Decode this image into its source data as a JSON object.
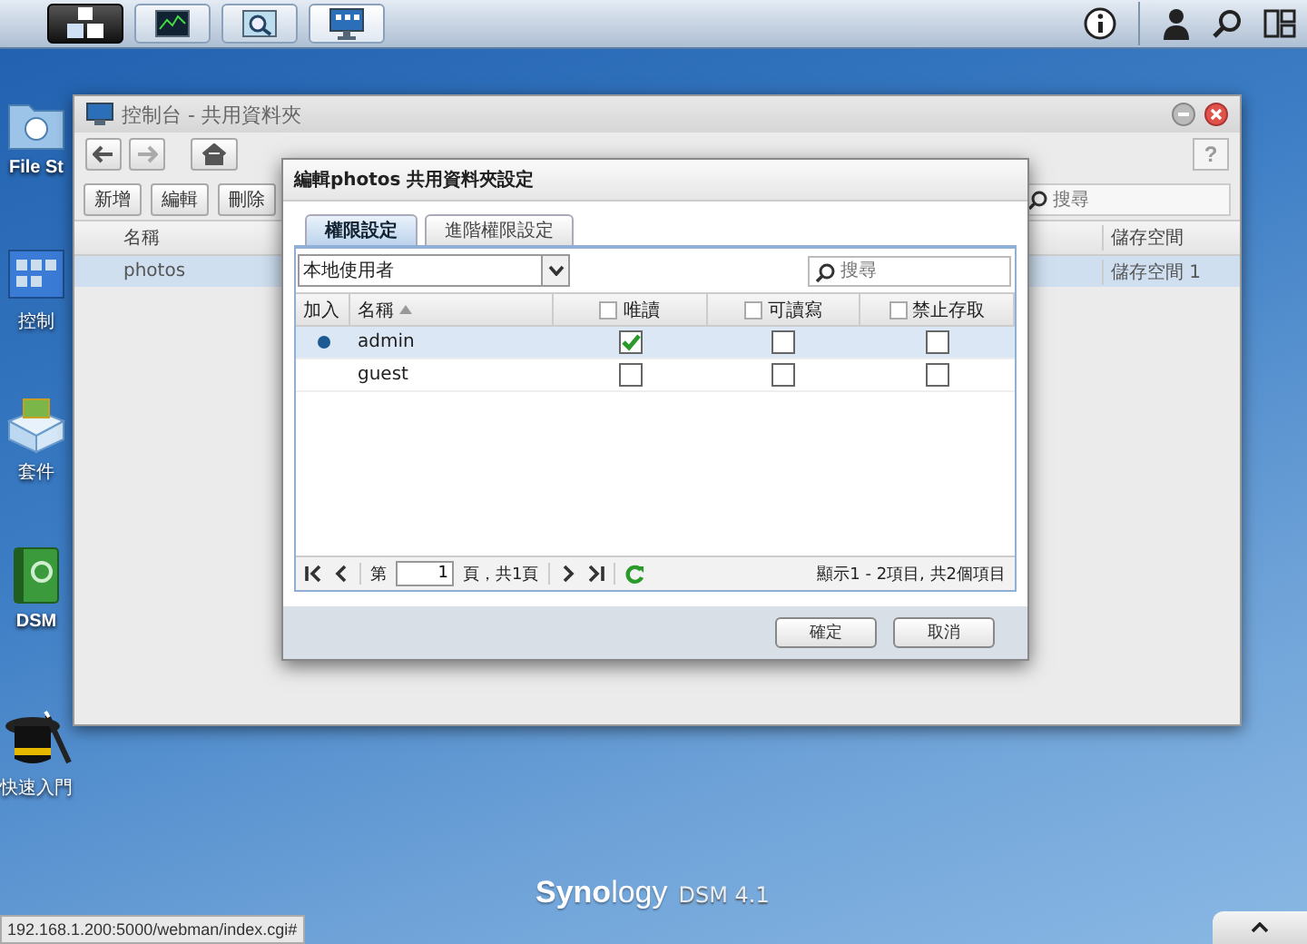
{
  "desktop_icons": [
    {
      "kind": "folder",
      "label": "File St"
    },
    {
      "kind": "control",
      "label": "控制"
    },
    {
      "kind": "package",
      "label": "套件"
    },
    {
      "kind": "book",
      "label": "DSM"
    },
    {
      "kind": "hat",
      "label": "快速入門"
    }
  ],
  "window": {
    "title": "控制台 - 共用資料夾",
    "toolbar_buttons": [
      "新增",
      "編輯",
      "刪除"
    ],
    "search": {
      "placeholder": "搜尋"
    },
    "help": "?",
    "columns": [
      "名稱",
      "儲存空間"
    ],
    "rows": [
      {
        "cells": [
          "photos",
          "儲存空間 1"
        ],
        "selected": true
      }
    ]
  },
  "dialog": {
    "title": "編輯photos 共用資料夾設定",
    "tabs": [
      {
        "label": "權限設定",
        "selected": true
      },
      {
        "label": "進階權限設定",
        "selected": false
      }
    ],
    "filter": "本地使用者",
    "search": {
      "placeholder": "搜尋"
    },
    "columns": [
      {
        "label": "加入",
        "kind": "plain"
      },
      {
        "label": "名稱",
        "kind": "sorted"
      },
      {
        "label": "唯讀",
        "kind": "check",
        "checked": false
      },
      {
        "label": "可讀寫",
        "kind": "check",
        "checked": false
      },
      {
        "label": "禁止存取",
        "kind": "check",
        "checked": false
      }
    ],
    "rows": [
      {
        "name": "admin",
        "added": true,
        "selected": true,
        "permissions": [
          true,
          false,
          false
        ]
      },
      {
        "name": "guest",
        "added": false,
        "selected": false,
        "permissions": [
          false,
          false,
          false
        ]
      }
    ],
    "pager": {
      "before": "第",
      "page": "1",
      "after": "頁，共1頁",
      "summary": "顯示1 - 2項目, 共2個項目"
    },
    "buttons": [
      "確定",
      "取消"
    ]
  },
  "brand": {
    "name": "**Syno**logy",
    "version": "DSM 4.1"
  },
  "status_bar": {
    "url": "192.168.1.200:5000/webman/index.cgi#"
  }
}
